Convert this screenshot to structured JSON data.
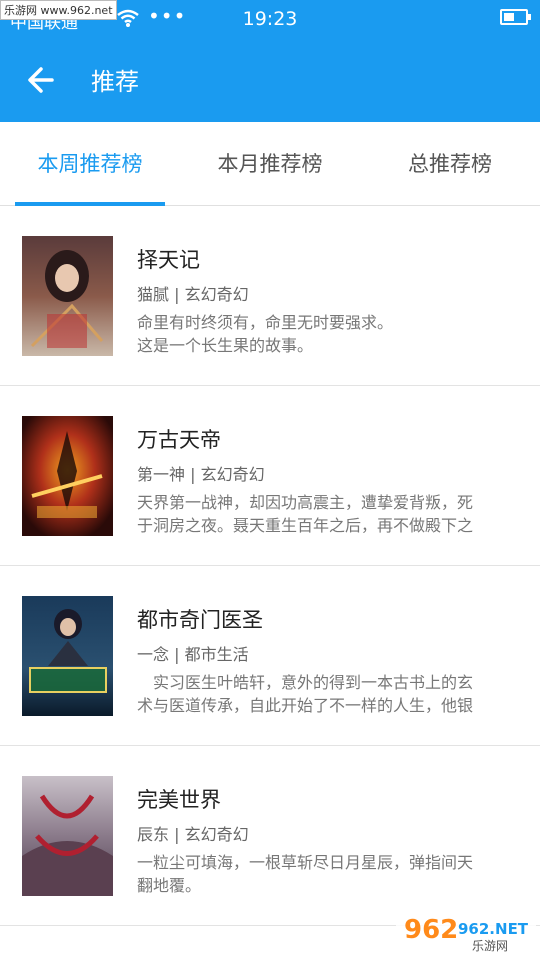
{
  "status_bar": {
    "carrier": "中国联通",
    "time": "19:23",
    "watermark": "乐游网 www.962.net"
  },
  "app_bar": {
    "title": "推荐"
  },
  "tabs": [
    {
      "label": "本周推荐榜",
      "active": true
    },
    {
      "label": "本月推荐榜",
      "active": false
    },
    {
      "label": "总推荐榜",
      "active": false
    }
  ],
  "books": [
    {
      "title": "择天记",
      "meta": "猫腻 | 玄幻奇幻",
      "desc_lines": [
        "命里有时终须有，命里无时要强求。",
        "这是一个长生果的故事。"
      ]
    },
    {
      "title": "万古天帝",
      "meta": "第一神 | 玄幻奇幻",
      "desc_lines": [
        "天界第一战神，却因功高震主，遭挚爱背叛，死",
        "于洞房之夜。聂天重生百年之后，再不做殿下之"
      ]
    },
    {
      "title": "都市奇门医圣",
      "meta": "一念 | 都市生活",
      "desc_lines": [
        "　实习医生叶皓轩，意外的得到一本古书上的玄",
        "术与医道传承，自此开始了不一样的人生，他银"
      ]
    },
    {
      "title": "完美世界",
      "meta": "辰东 | 玄幻奇幻",
      "desc_lines": [
        "一粒尘可填海，一根草斩尽日月星辰，弹指间天",
        "翻地覆。"
      ]
    }
  ],
  "watermark_bottom": {
    "brand": "962.NET",
    "sub": "乐游网"
  },
  "colors": {
    "primary": "#1a9bf0",
    "text_dark": "#222222",
    "text_meta": "#666666",
    "divider": "#e3e3e3"
  }
}
